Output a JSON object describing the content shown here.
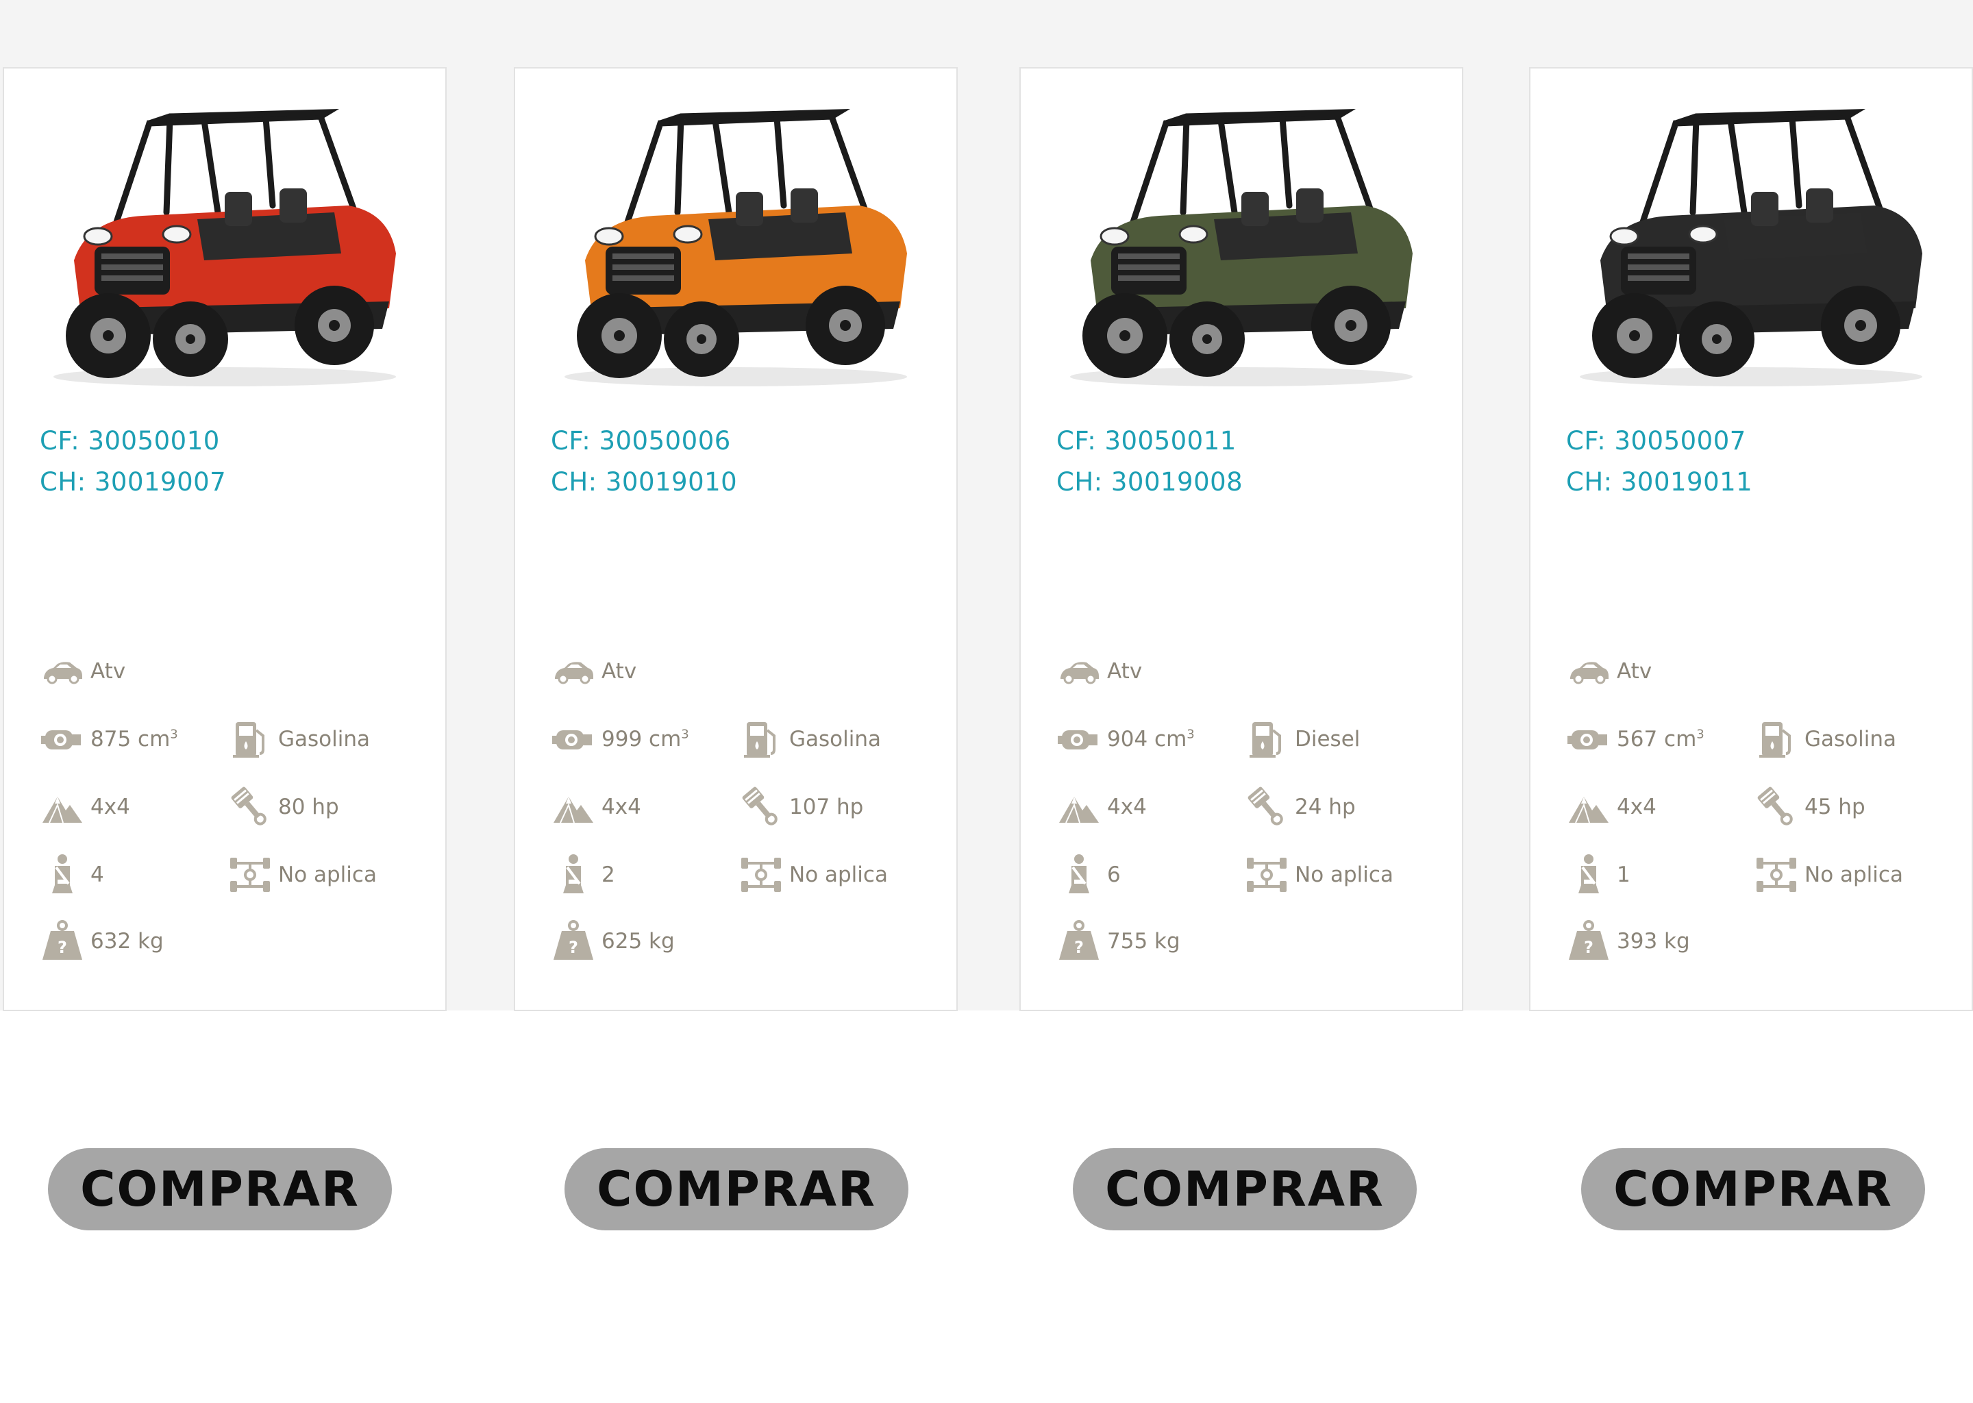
{
  "products": [
    {
      "image": "red-utv-4-seat",
      "body_color": "#d2321e",
      "cf": "CF: 30050010",
      "ch": "CH: 30019007",
      "type": "Atv",
      "displacement": "875 cm",
      "fuel": "Gasolina",
      "traction": "4x4",
      "power": "80 hp",
      "seats": "4",
      "transmission": "No aplica",
      "weight": "632 kg",
      "buy_label": "COMPRAR"
    },
    {
      "image": "orange-utv-2-seat",
      "body_color": "#e57a1c",
      "cf": "CF: 30050006",
      "ch": "CH: 30019010",
      "type": "Atv",
      "displacement": "999 cm",
      "fuel": "Gasolina",
      "traction": "4x4",
      "power": "107 hp",
      "seats": "2",
      "transmission": "No aplica",
      "weight": "625 kg",
      "buy_label": "COMPRAR"
    },
    {
      "image": "green-utv-6-seat",
      "body_color": "#4e5a3a",
      "cf": "CF: 30050011",
      "ch": "CH: 30019008",
      "type": "Atv",
      "displacement": "904 cm",
      "fuel": "Diesel",
      "traction": "4x4",
      "power": "24 hp",
      "seats": "6",
      "transmission": "No aplica",
      "weight": "755 kg",
      "buy_label": "COMPRAR"
    },
    {
      "image": "black-utv-1-seat",
      "body_color": "#2a2a2a",
      "cf": "CF: 30050007",
      "ch": "CH: 30019011",
      "type": "Atv",
      "displacement": "567 cm",
      "fuel": "Gasolina",
      "traction": "4x4",
      "power": "45 hp",
      "seats": "1",
      "transmission": "No aplica",
      "weight": "393 kg",
      "buy_label": "COMPRAR"
    }
  ],
  "displacement_unit_sup": "3",
  "colors": {
    "code_text": "#1d9fb4",
    "spec_text": "#8a8478",
    "icon": "#b5afa3",
    "button_bg": "#a6a6a6"
  },
  "icons": [
    "car-icon",
    "engine-icon",
    "fuel-pump-icon",
    "mountain-icon",
    "piston-icon",
    "seatbelt-icon",
    "drivetrain-icon",
    "weight-icon"
  ]
}
